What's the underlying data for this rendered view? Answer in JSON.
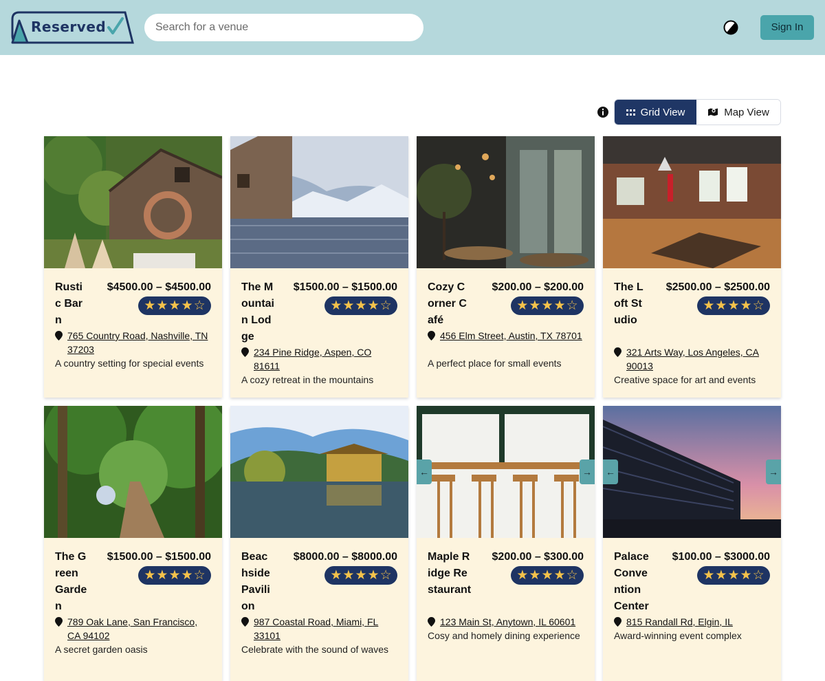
{
  "header": {
    "logo_text": "Reserved",
    "search_placeholder": "Search for a venue",
    "signin_label": "Sign In"
  },
  "toolbar": {
    "grid_label": "Grid View",
    "map_label": "Map View"
  },
  "venues": [
    {
      "name": "Rustic Barn",
      "price": "$4500.00 – $4500.00",
      "rating": 4,
      "address": "765 Country Road, Nashville, TN 37203",
      "description": "A country setting for special events"
    },
    {
      "name": "The Mountain Lodge",
      "price": "$1500.00 – $1500.00",
      "rating": 4,
      "address": "234 Pine Ridge, Aspen, CO 81611",
      "description": "A cozy retreat in the mountains"
    },
    {
      "name": "Cozy Corner Café",
      "price": "$200.00 – $200.00",
      "rating": 4,
      "address": "456 Elm Street, Austin, TX 78701",
      "description": "A perfect place for small events"
    },
    {
      "name": "The Loft Studio",
      "price": "$2500.00 – $2500.00",
      "rating": 4,
      "address": "321 Arts Way, Los Angeles, CA 90013",
      "description": "Creative space for art and events"
    },
    {
      "name": "The Green Garden",
      "price": "$1500.00 – $1500.00",
      "rating": 4,
      "address": "789 Oak Lane, San Francisco, CA 94102",
      "description": "A secret garden oasis"
    },
    {
      "name": "Beachside Pavilion",
      "price": "$8000.00 – $8000.00",
      "rating": 4,
      "address": "987 Coastal Road, Miami, FL 33101",
      "description": "Celebrate with the sound of waves"
    },
    {
      "name": "Maple Ridge Restaurant",
      "price": "$200.00 – $300.00",
      "rating": 4,
      "address": "123 Main St, Anytown, IL 60601",
      "description": "Cosy and homely dining experience"
    },
    {
      "name": "Palace Convention Center",
      "price": "$100.00 – $3000.00",
      "rating": 4,
      "address": "815 Randall Rd, Elgin, IL",
      "description": "Award-winning event complex"
    }
  ]
}
